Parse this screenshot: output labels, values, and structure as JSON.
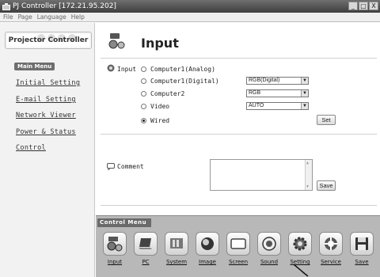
{
  "window": {
    "title": "PJ Controller [172.21.95.202]",
    "buttons": [
      "_",
      "□",
      "X"
    ]
  },
  "menubar": [
    "File",
    "Page",
    "Language",
    "Help"
  ],
  "sidebar": {
    "logo_text": "Projector Controller",
    "main_menu_label": "Main Menu",
    "items": [
      {
        "label": "Initial Setting"
      },
      {
        "label": "E-mail Setting"
      },
      {
        "label": "Network Viewer"
      },
      {
        "label": "Power & Status"
      },
      {
        "label": "Control"
      }
    ]
  },
  "page": {
    "title": "Input",
    "input_label": "Input",
    "options": [
      {
        "label": "Computer1(Analog)",
        "checked": false
      },
      {
        "label": "Computer1(Digital)",
        "checked": false,
        "select": "RGB(Digital)"
      },
      {
        "label": "Computer2",
        "checked": false,
        "select": "RGB"
      },
      {
        "label": "Video",
        "checked": false,
        "select": "AUTO"
      },
      {
        "label": "Wired",
        "checked": true
      }
    ],
    "set_button": "Set",
    "comment_label": "Comment",
    "comment_value": "",
    "save_button": "Save"
  },
  "control_menu": {
    "title": "Control Menu",
    "items": [
      {
        "label": "Input",
        "icon": "input-icon"
      },
      {
        "label": "PC",
        "icon": "pc-icon"
      },
      {
        "label": "System",
        "icon": "system-icon"
      },
      {
        "label": "Image",
        "icon": "image-icon"
      },
      {
        "label": "Screen",
        "icon": "screen-icon"
      },
      {
        "label": "Sound",
        "icon": "sound-icon"
      },
      {
        "label": "Setting",
        "icon": "setting-icon"
      },
      {
        "label": "Service",
        "icon": "service-icon"
      },
      {
        "label": "Save",
        "icon": "save-icon"
      }
    ]
  }
}
